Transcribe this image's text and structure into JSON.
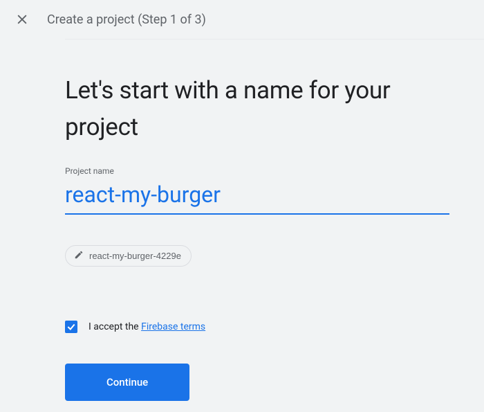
{
  "header": {
    "title": "Create a project (Step 1 of 3)"
  },
  "heading": "Let's start with a name for your project",
  "field": {
    "label": "Project name",
    "value": "react-my-burger"
  },
  "chip": {
    "text": "react-my-burger-4229e"
  },
  "terms": {
    "prefix": "I accept the ",
    "link": "Firebase terms",
    "checked": true
  },
  "continue_label": "Continue"
}
